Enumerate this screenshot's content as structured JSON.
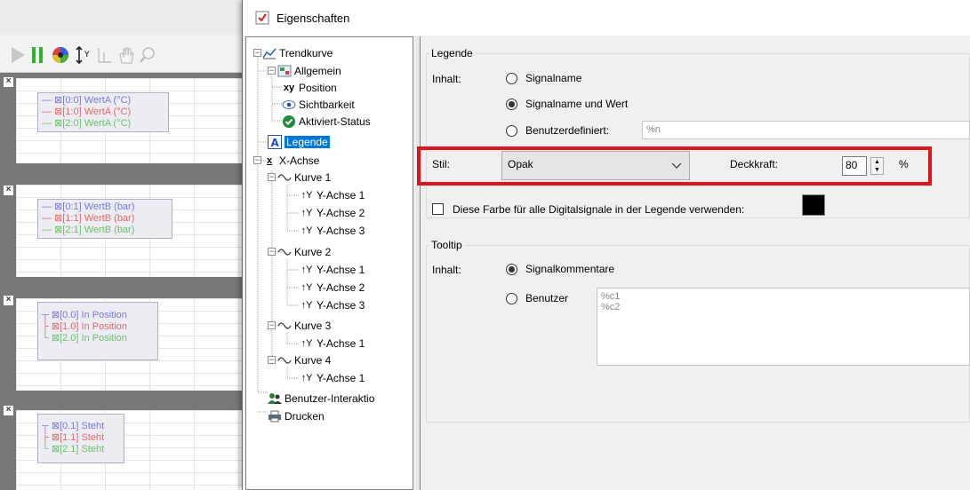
{
  "background_app": {
    "toolbar": {
      "icons": [
        "play-icon",
        "pause-icon",
        "color-wheel-icon",
        "axis-scale-icon",
        "cursor-icon",
        "hand-icon",
        "zoom-icon"
      ]
    },
    "tracks": [
      {
        "close": "×",
        "entries": [
          {
            "text": "[0:0] WertA (°C)",
            "color": "#7a7ae0"
          },
          {
            "text": "[1:0] WertA (°C)",
            "color": "#e06a6a"
          },
          {
            "text": "[2:0] WertA (°C)",
            "color": "#6ac46a"
          }
        ]
      },
      {
        "close": "×",
        "entries": [
          {
            "text": "[0:1] WertB (bar)",
            "color": "#7a7ae0"
          },
          {
            "text": "[1:1] WertB (bar)",
            "color": "#e06a6a"
          },
          {
            "text": "[2:1] WertB (bar)",
            "color": "#6ac46a"
          }
        ]
      },
      {
        "close": "×",
        "entries": [
          {
            "text": "[0.0]  In Position",
            "color": "#7a7ae0"
          },
          {
            "text": "[1.0] In Position",
            "color": "#e06a6a"
          },
          {
            "text": "[2.0] In Position",
            "color": "#6ac46a"
          }
        ]
      },
      {
        "close": "×",
        "entries": [
          {
            "text": "[0.1] Steht",
            "color": "#7a7ae0"
          },
          {
            "text": "[1.1] Steht",
            "color": "#e06a6a"
          },
          {
            "text": "[2.1] Steht",
            "color": "#6ac46a"
          }
        ]
      }
    ]
  },
  "dialog": {
    "title": "Eigenschaften",
    "tree": {
      "root": "Trendkurve",
      "allgemein": "Allgemein",
      "position": "Position",
      "sichtbarkeit": "Sichtbarkeit",
      "aktiviert": "Aktiviert-Status",
      "legende": "Legende",
      "xachse": "X-Achse",
      "kurve1": "Kurve 1",
      "kurve2": "Kurve 2",
      "kurve3": "Kurve 3",
      "kurve4": "Kurve 4",
      "yachse1": "Y-Achse 1",
      "yachse2": "Y-Achse 2",
      "yachse3": "Y-Achse 3",
      "benutzer": "Benutzer-Interaktio",
      "drucken": "Drucken"
    },
    "legende": {
      "group_title": "Legende",
      "inhalt_label": "Inhalt:",
      "option_signalname": "Signalname",
      "option_signalname_wert": "Signalname und Wert",
      "option_benutzerdefiniert": "Benutzerdefiniert:",
      "benutzerdefiniert_value": "%n",
      "stil_label": "Stil:",
      "stil_value": "Opak",
      "deckkraft_label": "Deckkraft:",
      "deckkraft_value": "80",
      "deckkraft_unit": "%",
      "digital_color_label": "Diese Farbe für alle Digitalsignale in der Legende verwenden:",
      "digital_color": "#000000"
    },
    "tooltip": {
      "group_title": "Tooltip",
      "inhalt_label": "Inhalt:",
      "option_signalkommentare": "Signalkommentare",
      "option_benutzer": "Benutzer",
      "benutzer_line1": "%c1",
      "benutzer_line2": "%c2"
    },
    "highlight_color": "#e0131c",
    "selected_color": "#0078d7"
  }
}
